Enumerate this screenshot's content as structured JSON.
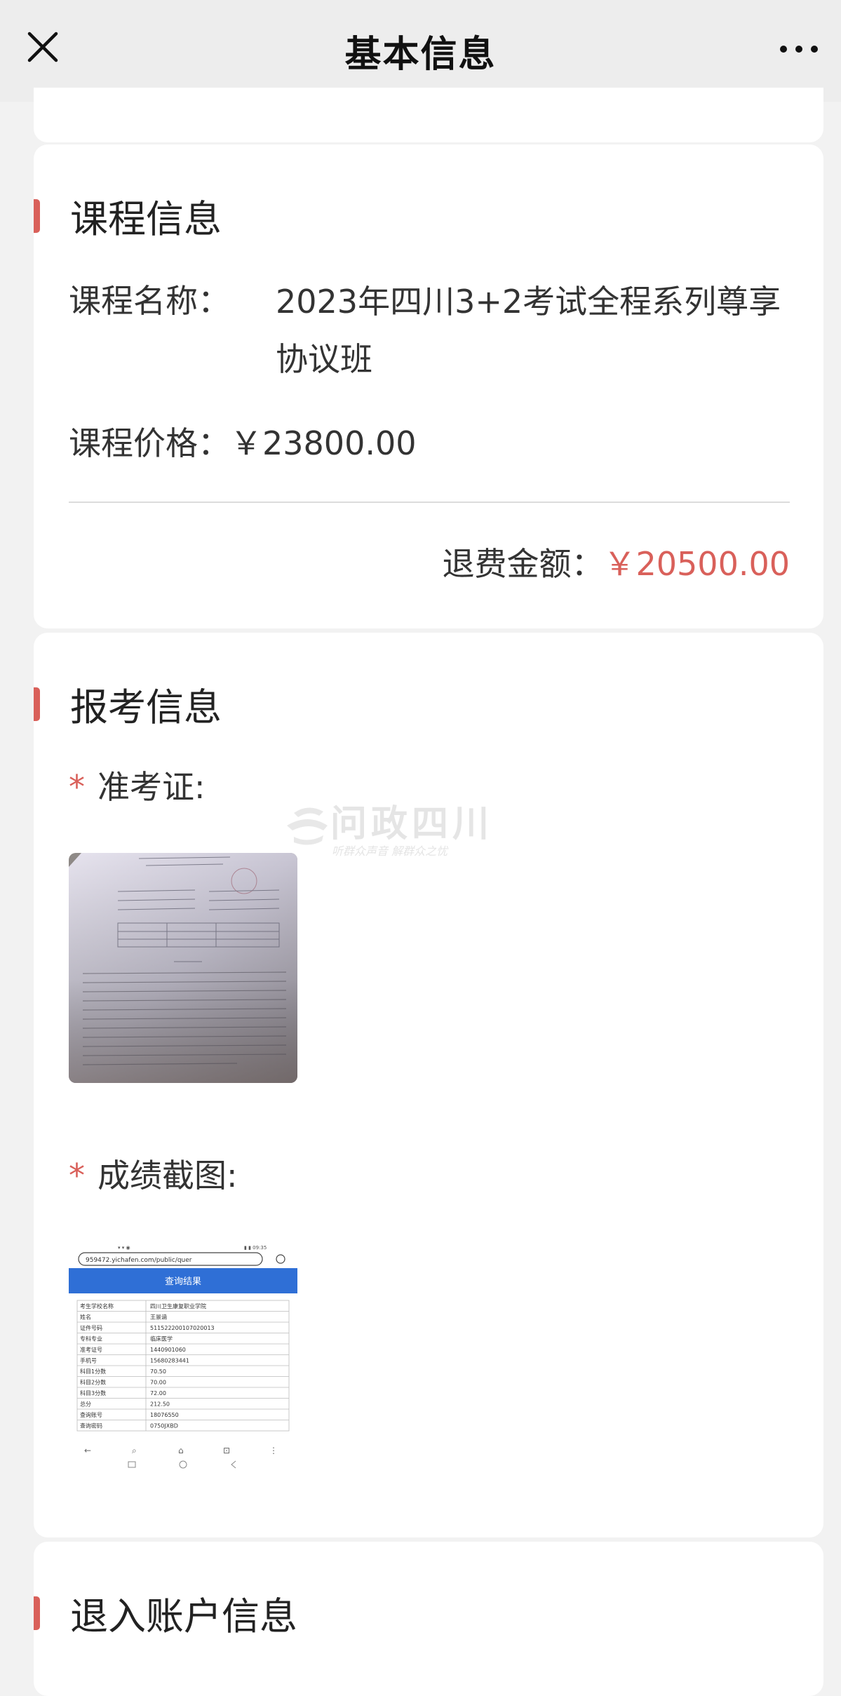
{
  "nav": {
    "title": "基本信息"
  },
  "course": {
    "section_title": "课程信息",
    "name_label": "课程名称：",
    "name_value_line1": "2023年四川3+2考试全程系列尊享",
    "name_value_line2": "协议班",
    "price_label": "课程价格：",
    "price_value": "￥23800.00",
    "refund_label": "退费金额：",
    "refund_value": "￥20500.00"
  },
  "exam": {
    "section_title": "报考信息",
    "admission_label": "准考证:",
    "score_label": "成绩截图:",
    "required_mark": "*"
  },
  "account": {
    "section_title": "退入账户信息"
  },
  "screenshot": {
    "url": "959472.yichafen.com/public/quer",
    "header": "查询结果",
    "rows": [
      [
        "考生学校名称",
        "四川卫生康复职业学院"
      ],
      [
        "姓名",
        "王景涵"
      ],
      [
        "证件号码",
        "511522200107020013"
      ],
      [
        "专科专业",
        "临床医学"
      ],
      [
        "准考证号",
        "1440901060"
      ],
      [
        "手机号",
        "15680283441"
      ],
      [
        "科目1分数",
        "70.50"
      ],
      [
        "科目2分数",
        "70.00"
      ],
      [
        "科目3分数",
        "72.00"
      ],
      [
        "总分",
        "212.50"
      ],
      [
        "查询账号",
        "18076550"
      ],
      [
        "查询密码",
        "0750JXBD"
      ]
    ]
  },
  "watermark": {
    "main": "问政四川",
    "sub": "听群众声音  解群众之忧"
  },
  "colors": {
    "accent": "#d9605a",
    "nav_bg": "#ededed",
    "page_bg": "#f2f2f2"
  }
}
